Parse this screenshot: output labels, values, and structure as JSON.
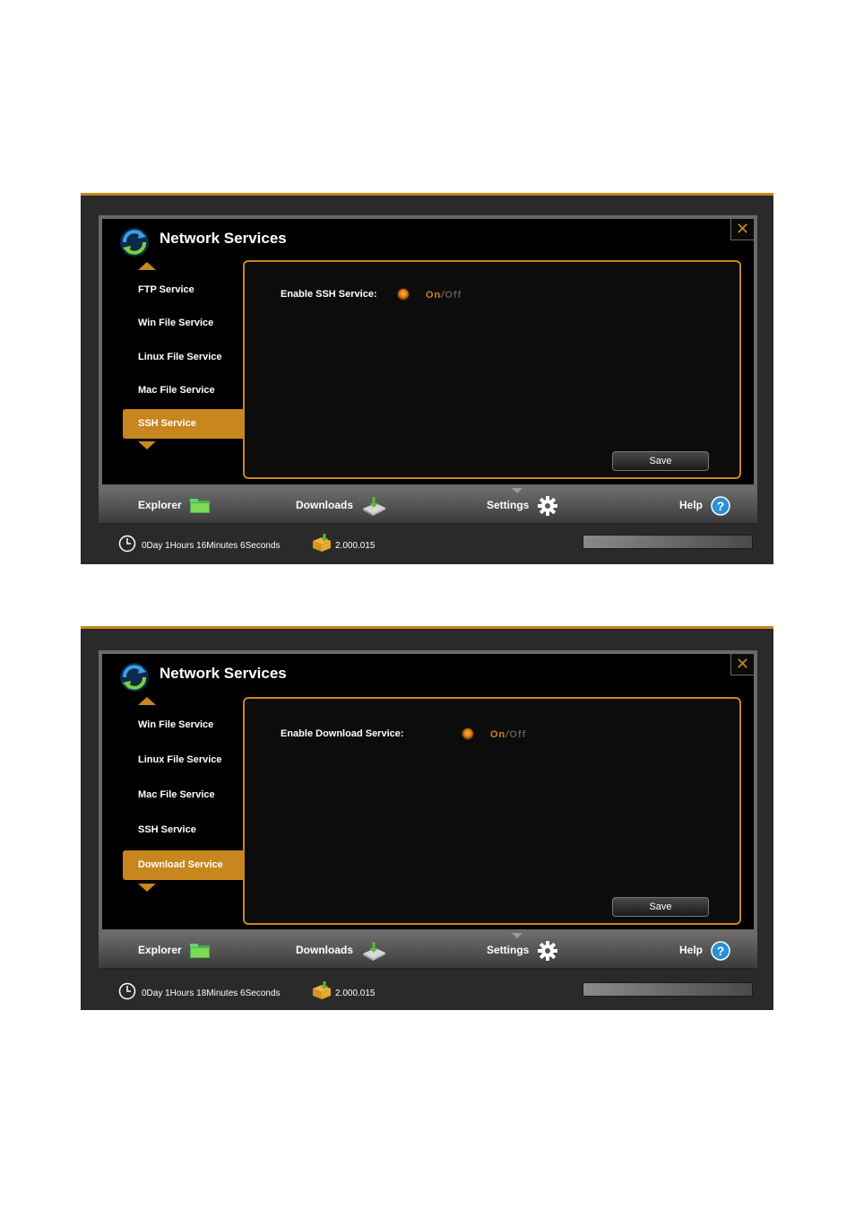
{
  "screens": [
    {
      "dialog_title": "Network Services",
      "close_glyph": "✕",
      "menu": [
        "FTP Service",
        "Win File Service",
        "Linux File Service",
        "Mac File Service",
        "SSH Service"
      ],
      "active_item": "SSH Service",
      "field_label": "Enable SSH Service:",
      "toggle": {
        "on": "On",
        "sep": "/",
        "off": "Off",
        "state": "on"
      },
      "save_label": "Save",
      "nav": {
        "explorer": "Explorer",
        "downloads": "Downloads",
        "settings": "Settings",
        "help": "Help",
        "active": "Settings"
      },
      "status": {
        "uptime": "0Day 1Hours 16Minutes 6Seconds",
        "version": "2.000.015"
      }
    },
    {
      "dialog_title": "Network Services",
      "close_glyph": "✕",
      "menu": [
        "Win File Service",
        "Linux File Service",
        "Mac File Service",
        "SSH Service",
        "Download Service"
      ],
      "active_item": "Download Service",
      "field_label": "Enable Download Service:",
      "toggle": {
        "on": "On",
        "sep": "/",
        "off": "Off",
        "state": "on"
      },
      "save_label": "Save",
      "nav": {
        "explorer": "Explorer",
        "downloads": "Downloads",
        "settings": "Settings",
        "help": "Help",
        "active": "Settings"
      },
      "status": {
        "uptime": "0Day 1Hours 18Minutes 6Seconds",
        "version": "2.000.015"
      }
    }
  ],
  "icons": {
    "logo": "refresh-logo-icon",
    "close": "close-icon",
    "scroll_up": "chevron-up-icon",
    "scroll_down": "chevron-down-icon",
    "toggle": "radio-icon",
    "explorer": "folder-icon",
    "downloads": "download-drive-icon",
    "settings": "gear-icon",
    "help": "help-icon",
    "clock": "clock-icon",
    "version": "package-icon"
  },
  "colors": {
    "accent": "#c8861e",
    "background": "#000000",
    "panel_border": "#c8861e"
  }
}
